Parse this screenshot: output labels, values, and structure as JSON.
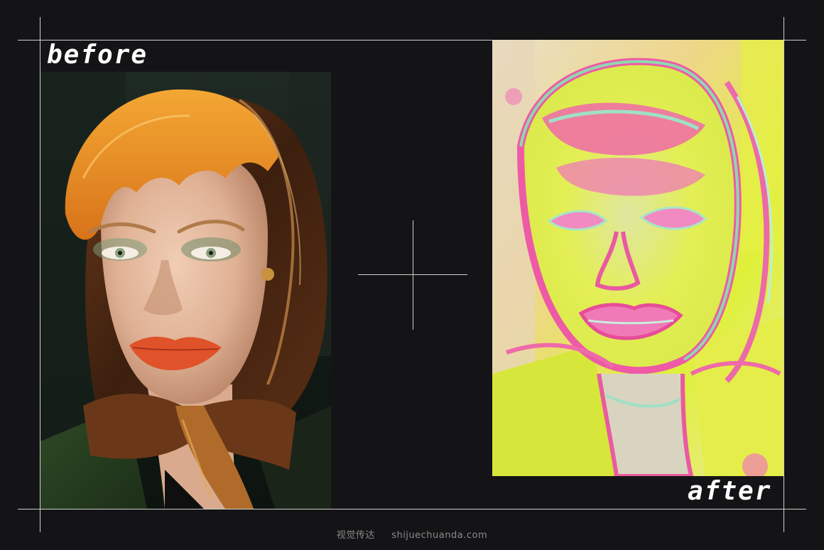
{
  "labels": {
    "before": "before",
    "after": "after"
  },
  "images": {
    "before": {
      "alt": "Original photo: woman with orange bangs and a brown patterned headscarf, red lips"
    },
    "after": {
      "alt": "Processed photo: neon thermal/holographic effect in pink, yellow and green"
    }
  },
  "watermark": {
    "cn": "视觉传达",
    "site": "shijuechuanda.com"
  },
  "colors": {
    "background": "#141416",
    "guides": "#cfcfcf",
    "label_text": "#ffffff",
    "watermark_text": "#8a8a8a"
  }
}
